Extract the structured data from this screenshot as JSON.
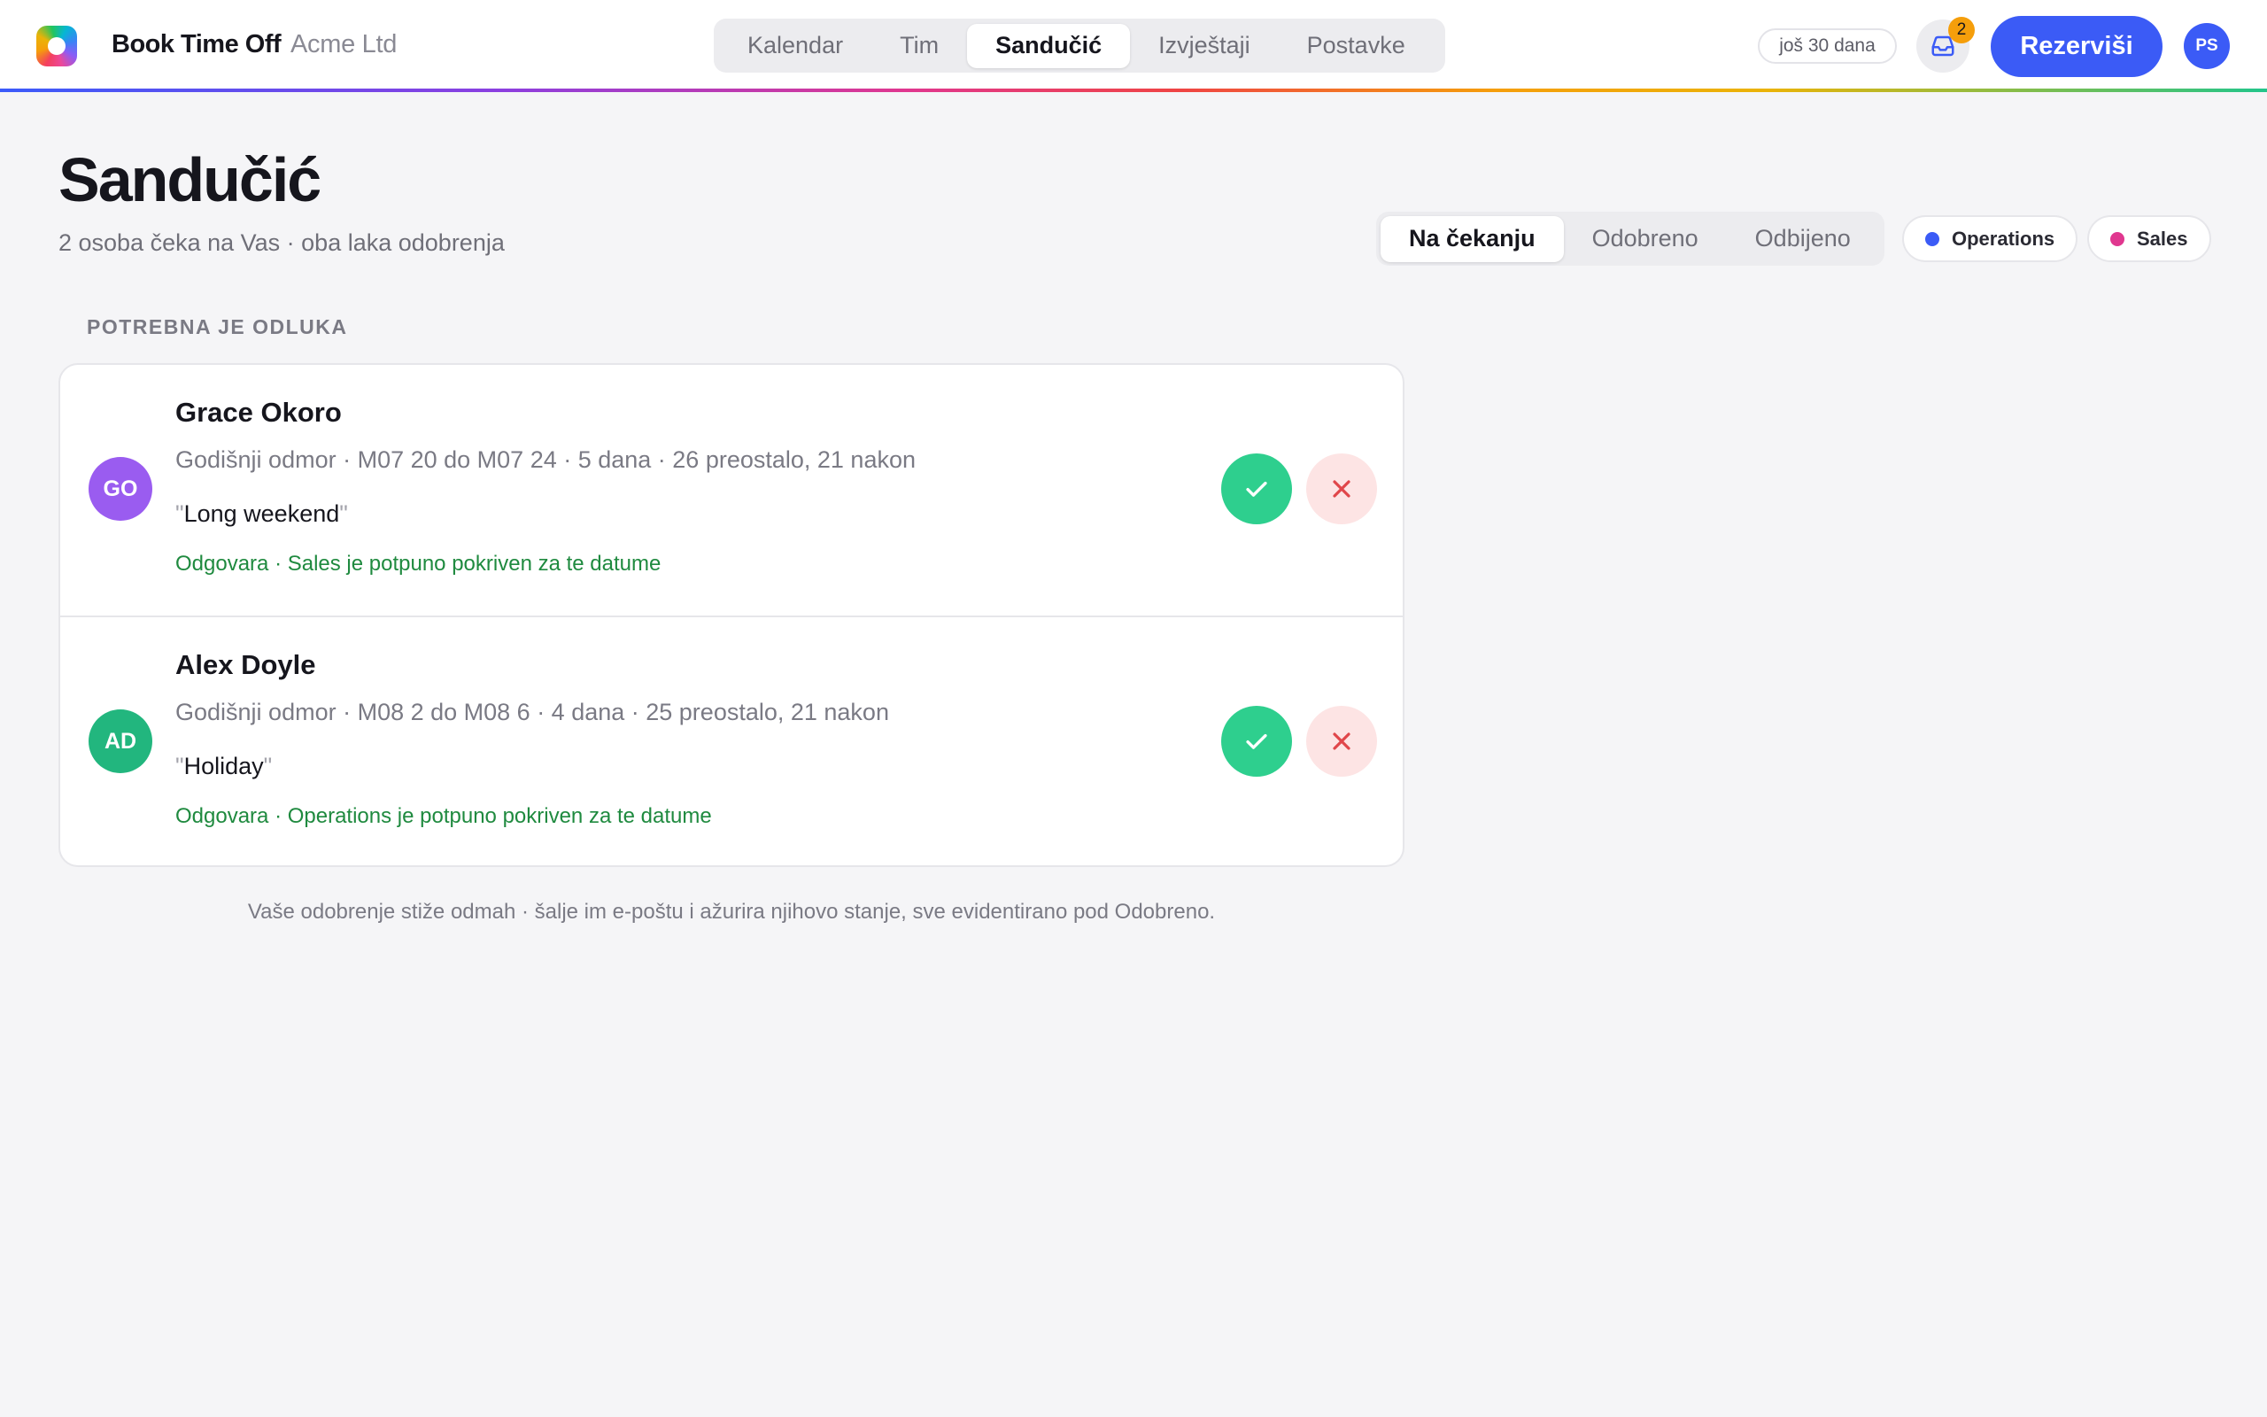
{
  "app": {
    "brand": "Book Time Off",
    "org": "Acme Ltd",
    "trial": "još 30 dana",
    "inbox_count": "2",
    "book_label": "Rezerviši",
    "user_initials": "PS",
    "logo_icon": "app-logo-icon"
  },
  "nav": {
    "tabs": [
      {
        "label": "Kalendar"
      },
      {
        "label": "Tim"
      },
      {
        "label": "Sandučić",
        "active": true
      },
      {
        "label": "Izvještaji"
      },
      {
        "label": "Postavke"
      }
    ]
  },
  "page": {
    "title": "Sandučić",
    "subtitle": "2 osoba čeka na Vas · oba laka odobrenja"
  },
  "status_tabs": [
    {
      "label": "Na čekanju",
      "active": true
    },
    {
      "label": "Odobreno"
    },
    {
      "label": "Odbijeno"
    }
  ],
  "team_chips": [
    {
      "label": "Operations",
      "color": "#3b5bf6"
    },
    {
      "label": "Sales",
      "color": "#e0378f"
    }
  ],
  "section_label": "POTREBNA JE ODLUKA",
  "requests": [
    {
      "initials": "GO",
      "avatar_color": "#9a5cf0",
      "name": "Grace Okoro",
      "meta": "Godišnji odmor · M07 20 do M07 24 · 5 dana · 26 preostalo, 21 nakon",
      "note": "Long weekend",
      "coverage": "Odgovara · Sales je potpuno pokriven za te datume"
    },
    {
      "initials": "AD",
      "avatar_color": "#22b67e",
      "name": "Alex Doyle",
      "meta": "Godišnji odmor · M08 2 do M08 6 · 4 dana · 25 preostalo, 21 nakon",
      "note": "Holiday",
      "coverage": "Odgovara · Operations je potpuno pokriven za te datume"
    }
  ],
  "footer_note": "Vaše odobrenje stiže odmah · šalje im e-poštu i ažurira njihovo stanje, sve evidentirano pod Odobreno.",
  "colors": {
    "accent": "#3b5bf6",
    "approve": "#2ecf8e",
    "reject_bg": "#fde4e4",
    "reject_icon": "#e0464a",
    "coverage_text": "#1f8a3f",
    "badge": "#f59e0b"
  }
}
